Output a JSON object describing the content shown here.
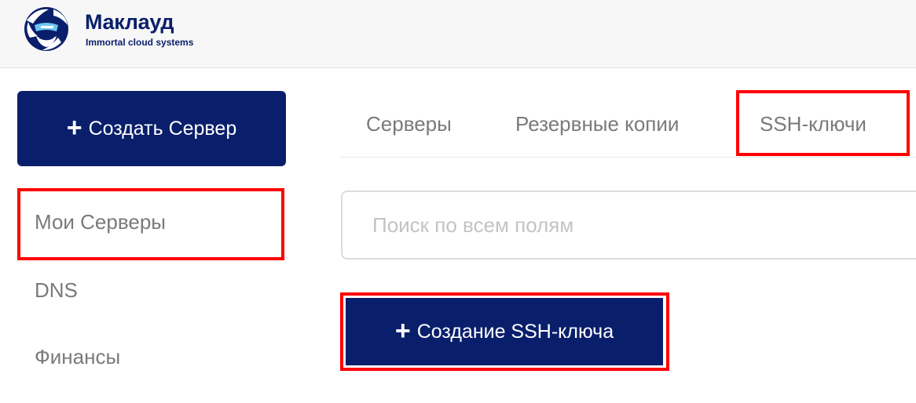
{
  "header": {
    "brand_name": "Маклауд",
    "tagline": "Immortal cloud systems",
    "logo_icon": "mascot-logo-icon",
    "brand_color": "#0a1f6b"
  },
  "sidebar": {
    "create_button": {
      "icon": "plus-icon",
      "label": "Создать Сервер"
    },
    "items": [
      {
        "label": "Мои Серверы",
        "highlighted": true
      },
      {
        "label": "DNS",
        "highlighted": false
      },
      {
        "label": "Финансы",
        "highlighted": false
      }
    ]
  },
  "main": {
    "tabs": [
      {
        "label": "Серверы",
        "highlighted": false
      },
      {
        "label": "Резервные копии",
        "highlighted": false
      },
      {
        "label": "SSH-ключи",
        "highlighted": true
      }
    ],
    "search": {
      "placeholder": "Поиск по всем полям",
      "value": ""
    },
    "create_ssh_button": {
      "icon": "plus-icon",
      "label": "Создание SSH-ключа",
      "highlighted": true
    }
  },
  "colors": {
    "primary": "#0a1f6b",
    "highlight_frame": "#ff0000",
    "text_muted": "#7a7a7a",
    "header_bg": "#f7f7f7"
  }
}
